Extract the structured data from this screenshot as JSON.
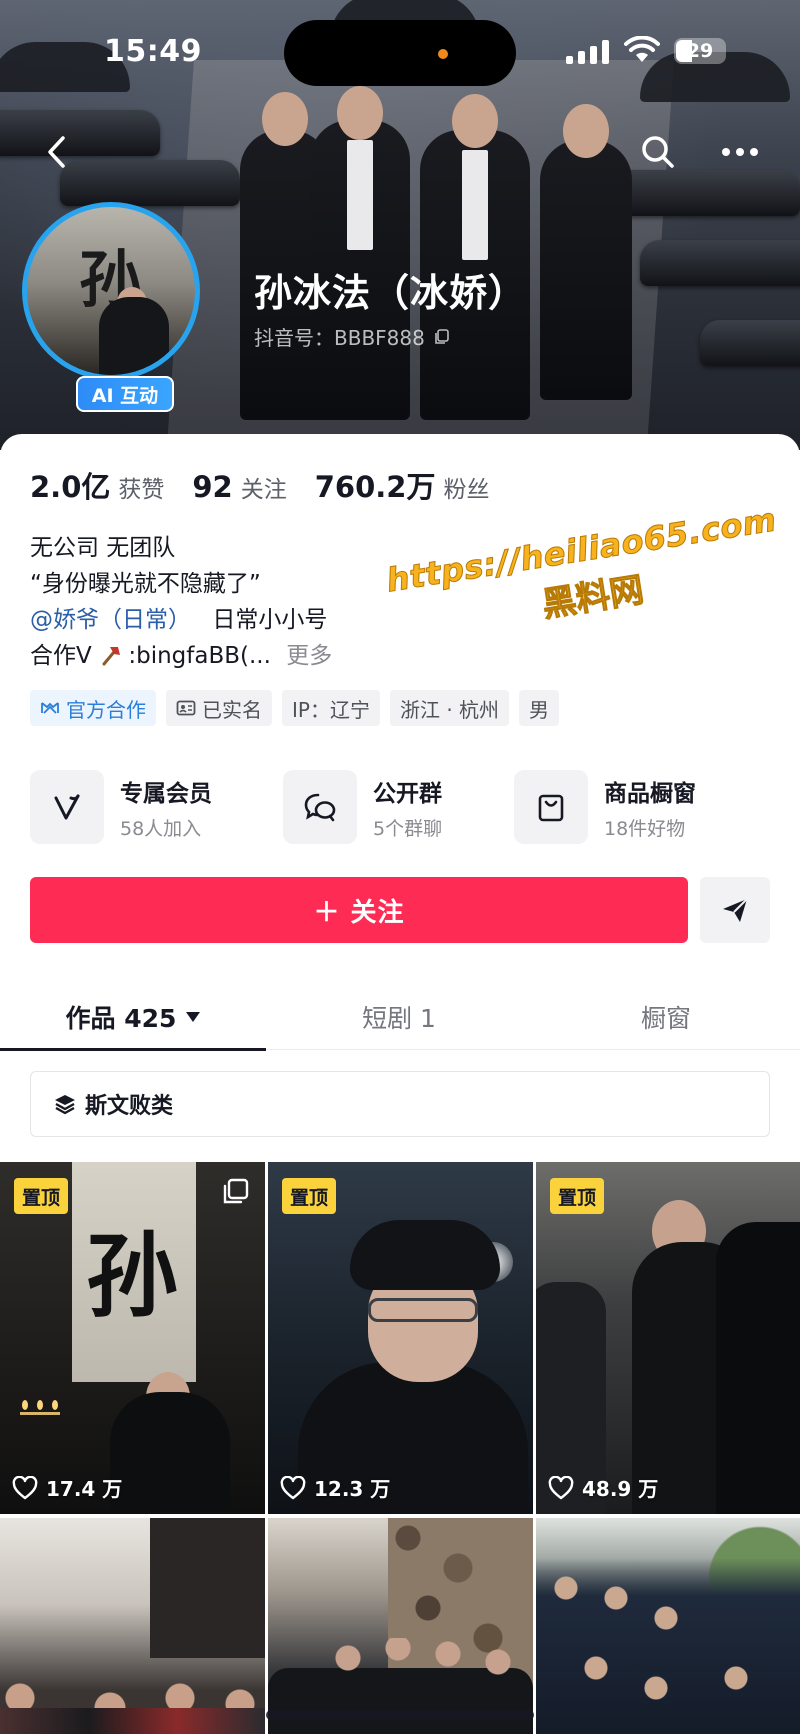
{
  "status_bar": {
    "time": "15:49",
    "battery": "29"
  },
  "profile": {
    "name": "孙冰法（冰娇）",
    "douyin_id": "抖音号：BBBF888",
    "ai_badge": "AI 互动",
    "avatar_calligraphy": "孙"
  },
  "stats": [
    {
      "value": "2.0亿",
      "label": "获赞"
    },
    {
      "value": "92",
      "label": "关注"
    },
    {
      "value": "760.2万",
      "label": "粉丝"
    }
  ],
  "bio": {
    "line1": "无公司 无团队",
    "line2": "“身份曝光就不隐藏了”",
    "mention": "@娇爷（日常）",
    "line3_suffix": "日常小小号",
    "line4_prefix": "合作Ⅴ",
    "line4_suffix": ":bingfaBB(...",
    "more": "更多"
  },
  "watermark": {
    "url": "https://heiliao65.com",
    "name": "黑料网"
  },
  "tags": [
    {
      "label": "官方合作",
      "icon": "handshake-icon"
    },
    {
      "label": "已实名",
      "icon": "id-card-icon"
    },
    {
      "label": "IP：辽宁"
    },
    {
      "label": "浙江 · 杭州"
    },
    {
      "label": "男"
    }
  ],
  "services": [
    {
      "title": "专属会员",
      "sub": "58人加入",
      "icon": "vip-v-icon"
    },
    {
      "title": "公开群",
      "sub": "5个群聊",
      "icon": "group-chat-icon"
    },
    {
      "title": "商品橱窗",
      "sub": "18件好物",
      "icon": "shop-bag-icon"
    }
  ],
  "follow_button": "＋ 关注",
  "tabs": [
    {
      "label": "作品 425",
      "active": true
    },
    {
      "label": "短剧 1"
    },
    {
      "label": "橱窗"
    }
  ],
  "collection": {
    "label": "斯文败类"
  },
  "videos": [
    {
      "pinned": "置顶",
      "likes": "17.4 万"
    },
    {
      "pinned": "置顶",
      "likes": "12.3 万"
    },
    {
      "pinned": "置顶",
      "likes": "48.9 万"
    },
    {
      "likes": ""
    },
    {
      "likes": ""
    },
    {
      "likes": ""
    }
  ],
  "colors": {
    "accent": "#fe2c55",
    "link": "#2a5ea8",
    "ring": "#28a4ef",
    "pin": "#fad33c"
  }
}
